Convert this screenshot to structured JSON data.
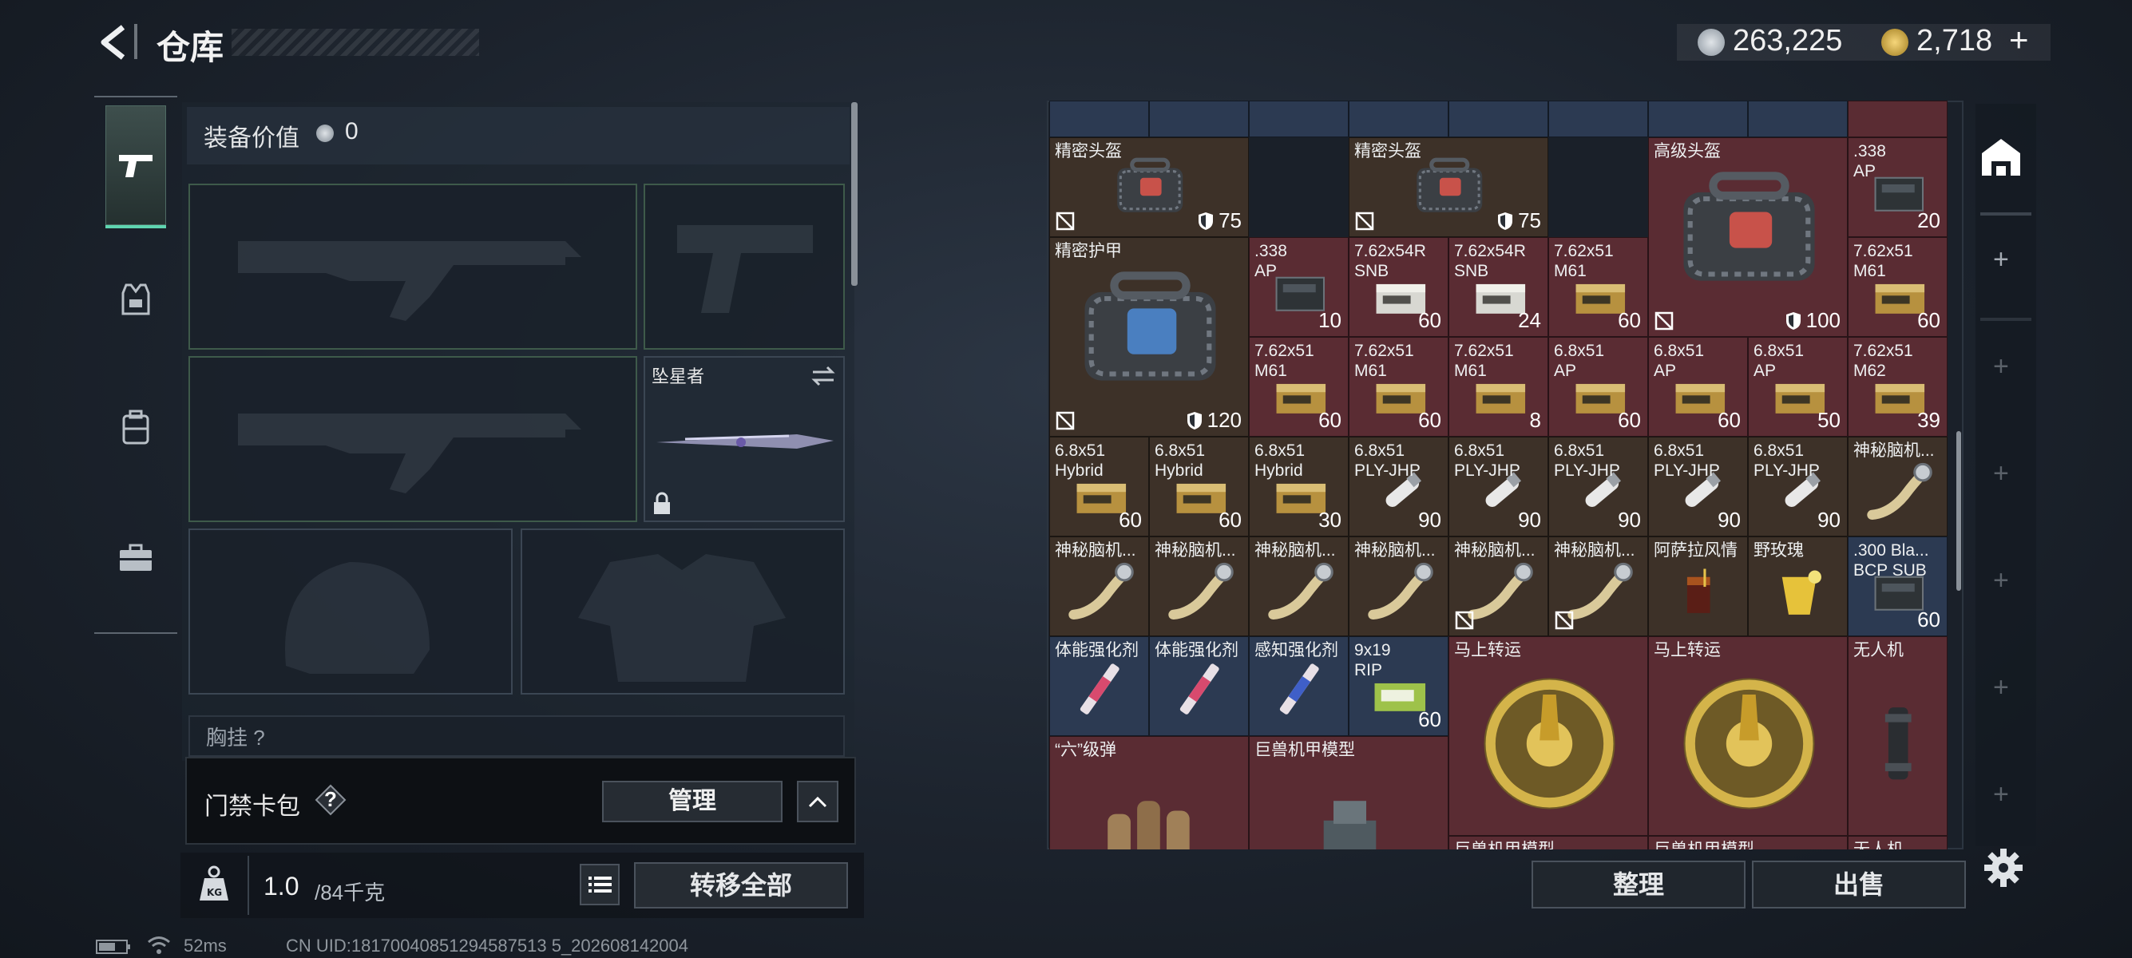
{
  "header": {
    "title": "仓库",
    "currency_silver": "263,225",
    "currency_gold": "2,718",
    "currency_add": "+"
  },
  "loadout": {
    "equip_value_label": "装备价值",
    "equip_value": "0",
    "melee_name": "坠星者",
    "chest_label": "胸挂 ?"
  },
  "access_card": {
    "label": "门禁卡包",
    "help": "?",
    "manage_label": "管理"
  },
  "weight": {
    "current": "1.0",
    "max": "/84千克",
    "transfer_all_label": "转移全部"
  },
  "status": {
    "ping": "52ms",
    "uid": "CN UID:18170040851294587513 5_202608142004"
  },
  "stash": {
    "sort_label": "整理",
    "sell_label": "出售",
    "items": [
      {
        "name": "精密头盔",
        "armor": "75",
        "bind": true
      },
      {
        "name": "精密头盔",
        "armor": "75",
        "bind": true
      },
      {
        "name": "高级头盔",
        "armor": "100",
        "bind": true
      },
      {
        "name": ".338\nAP",
        "qty": "20"
      },
      {
        "name": "精密护甲",
        "armor": "120",
        "bind": true
      },
      {
        "name": ".338\nAP",
        "qty": "10"
      },
      {
        "name": "7.62x54R\nSNB",
        "qty": "60"
      },
      {
        "name": "7.62x54R\nSNB",
        "qty": "24"
      },
      {
        "name": "7.62x51\nM61",
        "qty": "60"
      },
      {
        "name": "7.62x51\nM61",
        "qty": "60"
      },
      {
        "name": "7.62x51\nM61",
        "qty": "60"
      },
      {
        "name": "7.62x51\nM61",
        "qty": "60"
      },
      {
        "name": "7.62x51\nM61",
        "qty": "8"
      },
      {
        "name": "6.8x51\nAP",
        "qty": "60"
      },
      {
        "name": "6.8x51\nAP",
        "qty": "60"
      },
      {
        "name": "6.8x51\nAP",
        "qty": "50"
      },
      {
        "name": "7.62x51\nM62",
        "qty": "39"
      },
      {
        "name": "6.8x51\nHybrid",
        "qty": "60"
      },
      {
        "name": "6.8x51\nHybrid",
        "qty": "60"
      },
      {
        "name": "6.8x51\nHybrid",
        "qty": "30"
      },
      {
        "name": "6.8x51\nPLY-JHP",
        "qty": "90"
      },
      {
        "name": "6.8x51\nPLY-JHP",
        "qty": "90"
      },
      {
        "name": "6.8x51\nPLY-JHP",
        "qty": "90"
      },
      {
        "name": "6.8x51\nPLY-JHP",
        "qty": "90"
      },
      {
        "name": "6.8x51\nPLY-JHP",
        "qty": "90"
      },
      {
        "name": "神秘脑机..."
      },
      {
        "name": "神秘脑机..."
      },
      {
        "name": "神秘脑机..."
      },
      {
        "name": "神秘脑机..."
      },
      {
        "name": "神秘脑机..."
      },
      {
        "name": "神秘脑机...",
        "bind": true
      },
      {
        "name": "神秘脑机...",
        "bind": true
      },
      {
        "name": "阿萨拉风情"
      },
      {
        "name": "野玫瑰"
      },
      {
        "name": ".300 Bla...\nBCP SUB",
        "qty": "60"
      },
      {
        "name": "体能强化剂"
      },
      {
        "name": "体能强化剂"
      },
      {
        "name": "感知强化剂"
      },
      {
        "name": "9x19\nRIP",
        "qty": "60"
      },
      {
        "name": "马上转运"
      },
      {
        "name": "马上转运"
      },
      {
        "name": "无人机"
      },
      {
        "name": "“六”级弹"
      },
      {
        "name": "巨兽机甲模型"
      },
      {
        "name": "巨兽机甲模型"
      },
      {
        "name": "巨兽机甲模型"
      },
      {
        "name": "无人机"
      }
    ]
  },
  "colors": {
    "accent": "#5fd4b0",
    "rare_red": "#5a2c33",
    "brown": "#3d3128",
    "blue": "#2c3a52",
    "gold": "#c9a43a"
  }
}
